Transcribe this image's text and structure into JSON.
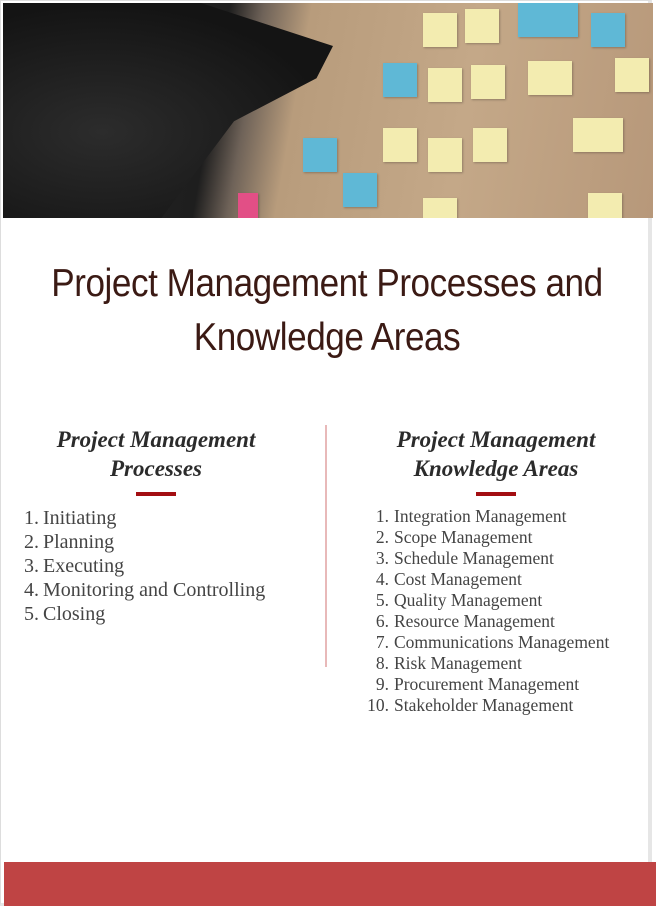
{
  "hero_image": {
    "description_icon": "sticky-notes-wall-photo"
  },
  "title": "Project Management Processes and Knowledge Areas",
  "processes": {
    "heading": "Project Management Processes",
    "items": [
      "Initiating",
      "Planning",
      "Executing",
      "Monitoring and Controlling",
      "Closing"
    ]
  },
  "knowledge_areas": {
    "heading": "Project Management Knowledge Areas",
    "items": [
      "Integration Management",
      "Scope Management",
      "Schedule Management",
      "Cost Management",
      "Quality Management",
      "Resource Management",
      "Communications Management",
      "Risk Management",
      "Procurement Management",
      "Stakeholder Management"
    ]
  },
  "colors": {
    "accent": "#a30e12",
    "footer": "#bf4444",
    "divider": "#e8b9b9",
    "title": "#3b1a14"
  }
}
